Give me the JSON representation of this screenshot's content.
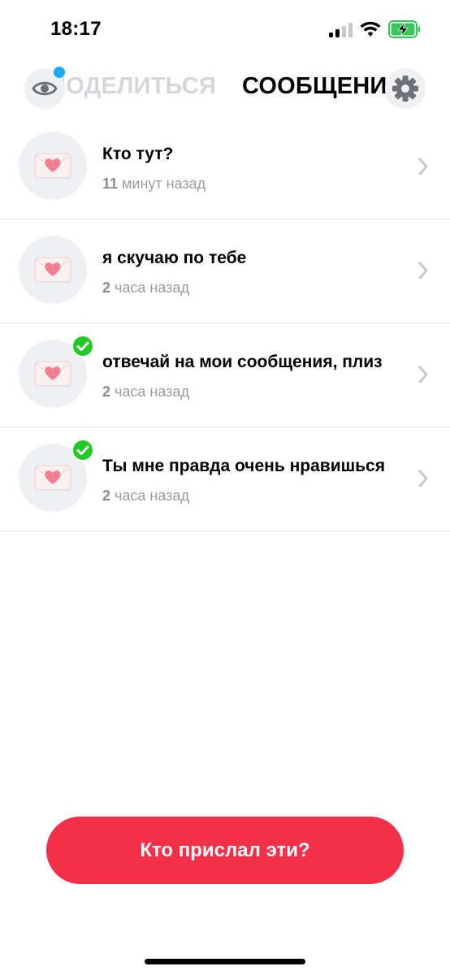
{
  "status_bar": {
    "time": "18:17",
    "battery_color": "#35c759"
  },
  "header": {
    "tabs": [
      {
        "label": "ПОДЕЛИТЬСЯ",
        "active": false
      },
      {
        "label": "СООБЩЕНИЯ",
        "active": true
      }
    ],
    "eye_icon": "eye-icon",
    "settings_icon": "gear-icon",
    "notification_dot_color": "#1aabf3"
  },
  "messages": [
    {
      "title": "Кто тут?",
      "time_number": "11",
      "time_unit": "минут назад",
      "read": false
    },
    {
      "title": "я скучаю по тебе",
      "time_number": "2",
      "time_unit": "часа назад",
      "read": false
    },
    {
      "title": "отвечай на мои сообщения, плиз",
      "time_number": "2",
      "time_unit": "часа назад",
      "read": true
    },
    {
      "title": "Ты мне правда очень нравишься",
      "time_number": "2",
      "time_unit": "часа назад",
      "read": true
    }
  ],
  "cta": {
    "label": "Кто прислал эти?",
    "color": "#f2304a"
  },
  "colors": {
    "accent": "#f2304a",
    "check": "#22c925",
    "muted_text": "#9a9ca3"
  }
}
